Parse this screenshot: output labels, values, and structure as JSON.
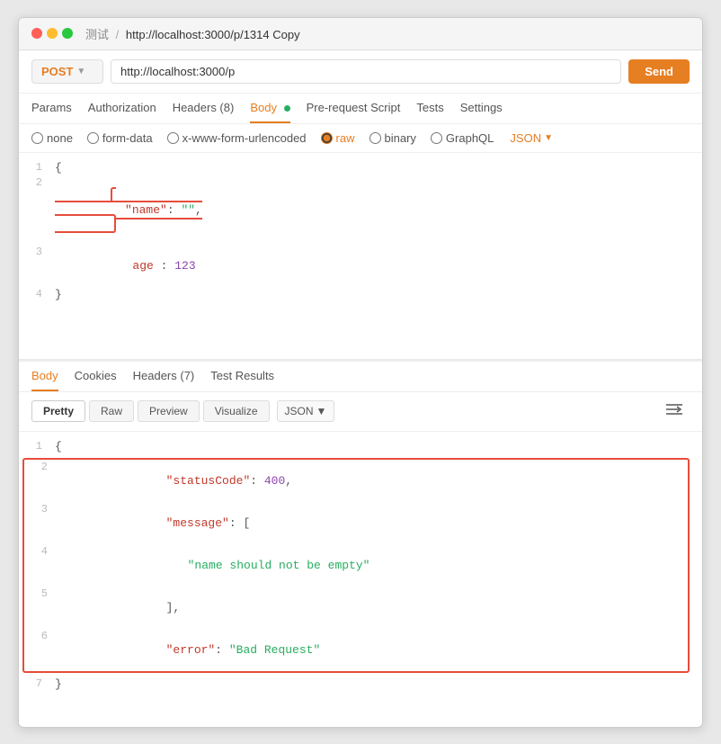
{
  "window": {
    "title": "测试 / http://localhost:3000/p/1314 Copy",
    "breadcrumb_prefix": "测试",
    "breadcrumb_sep": "/",
    "breadcrumb_path": "http://localhost:3000/p/1314 Copy"
  },
  "request": {
    "method": "POST",
    "url": "http://localhost:3000/p",
    "send_label": "Send"
  },
  "tabs": [
    {
      "label": "Params",
      "active": false
    },
    {
      "label": "Authorization",
      "active": false
    },
    {
      "label": "Headers (8)",
      "active": false
    },
    {
      "label": "Body",
      "active": true,
      "dot": true
    },
    {
      "label": "Pre-request Script",
      "active": false
    },
    {
      "label": "Tests",
      "active": false
    },
    {
      "label": "Settings",
      "active": false
    }
  ],
  "body_options": [
    {
      "label": "none",
      "value": "none",
      "checked": false
    },
    {
      "label": "form-data",
      "value": "form-data",
      "checked": false
    },
    {
      "label": "x-www-form-urlencoded",
      "value": "urlencoded",
      "checked": false
    },
    {
      "label": "raw",
      "value": "raw",
      "checked": true
    },
    {
      "label": "binary",
      "value": "binary",
      "checked": false
    },
    {
      "label": "GraphQL",
      "value": "graphql",
      "checked": false
    }
  ],
  "json_format": "JSON",
  "code_lines": [
    {
      "num": "1",
      "content": "{",
      "highlighted": false
    },
    {
      "num": "2",
      "content": "    \"name\": \"\",",
      "highlighted": true
    },
    {
      "num": "3",
      "content": "    age : 123",
      "highlighted": false
    },
    {
      "num": "4",
      "content": "}",
      "highlighted": false
    }
  ],
  "response": {
    "tabs": [
      {
        "label": "Body",
        "active": true
      },
      {
        "label": "Cookies",
        "active": false
      },
      {
        "label": "Headers (7)",
        "active": false
      },
      {
        "label": "Test Results",
        "active": false
      }
    ],
    "view_buttons": [
      {
        "label": "Pretty",
        "active": true
      },
      {
        "label": "Raw",
        "active": false
      },
      {
        "label": "Preview",
        "active": false
      },
      {
        "label": "Visualize",
        "active": false
      }
    ],
    "format": "JSON",
    "lines": [
      {
        "num": "1",
        "content": "{",
        "highlighted": false
      },
      {
        "num": "2",
        "content": "    \"statusCode\": 400,",
        "highlighted": true
      },
      {
        "num": "3",
        "content": "    \"message\": [",
        "highlighted": true
      },
      {
        "num": "4",
        "content": "        \"name should not be empty\"",
        "highlighted": true
      },
      {
        "num": "5",
        "content": "    ],",
        "highlighted": true
      },
      {
        "num": "6",
        "content": "    \"error\": \"Bad Request\"",
        "highlighted": true
      },
      {
        "num": "7",
        "content": "}",
        "highlighted": false
      }
    ]
  }
}
